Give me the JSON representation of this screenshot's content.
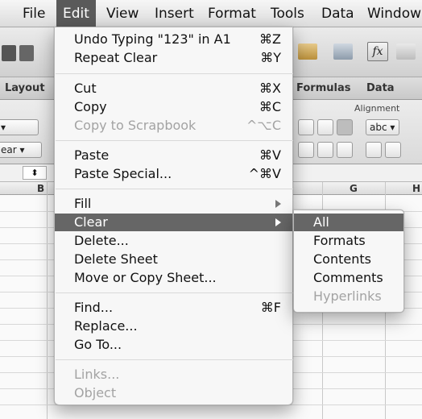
{
  "menubar": {
    "items": [
      "File",
      "Edit",
      "View",
      "Insert",
      "Format",
      "Tools",
      "Data",
      "Window"
    ]
  },
  "ribbon": {
    "tabs": [
      "Layout",
      "Formulas",
      "Data"
    ],
    "alignment_label": "Alignment",
    "abc_label": "abc",
    "clear_fragment": "ear"
  },
  "columns": [
    "B",
    "G",
    "H"
  ],
  "edit_menu": {
    "undo": {
      "label": "Undo Typing \"123\" in A1",
      "shortcut": "⌘Z"
    },
    "repeat": {
      "label": "Repeat Clear",
      "shortcut": "⌘Y"
    },
    "cut": {
      "label": "Cut",
      "shortcut": "⌘X"
    },
    "copy": {
      "label": "Copy",
      "shortcut": "⌘C"
    },
    "copy_scrapbook": {
      "label": "Copy to Scrapbook",
      "shortcut": "^⌥C"
    },
    "paste": {
      "label": "Paste",
      "shortcut": "⌘V"
    },
    "paste_special": {
      "label": "Paste Special...",
      "shortcut": "^⌘V"
    },
    "fill": {
      "label": "Fill"
    },
    "clear": {
      "label": "Clear"
    },
    "delete": {
      "label": "Delete..."
    },
    "delete_sheet": {
      "label": "Delete Sheet"
    },
    "move_copy": {
      "label": "Move or Copy Sheet..."
    },
    "find": {
      "label": "Find...",
      "shortcut": "⌘F"
    },
    "replace": {
      "label": "Replace..."
    },
    "goto": {
      "label": "Go To..."
    },
    "links": {
      "label": "Links..."
    },
    "object": {
      "label": "Object"
    }
  },
  "clear_submenu": {
    "all": "All",
    "formats": "Formats",
    "contents": "Contents",
    "comments": "Comments",
    "hyperlinks": "Hyperlinks"
  }
}
